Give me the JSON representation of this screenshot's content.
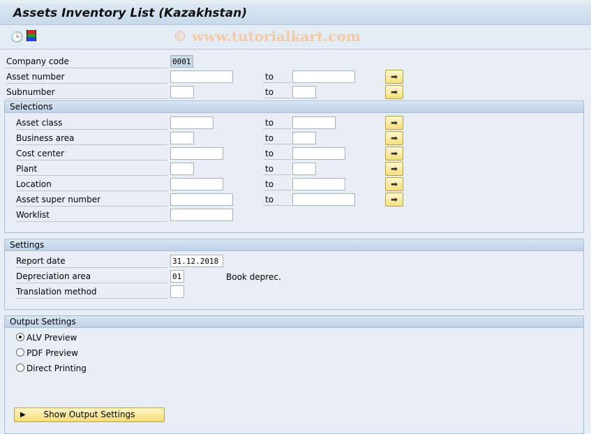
{
  "title": "Assets Inventory List (Kazakhstan)",
  "toolbar": {
    "execute_icon": "clock-execute-icon",
    "variant_icon": "selection-options-icon"
  },
  "watermark": "© www.tutorialkart.com",
  "to_label": "to",
  "main": {
    "company_code": {
      "label": "Company code",
      "value": "0001"
    },
    "asset_number": {
      "label": "Asset number"
    },
    "subnumber": {
      "label": "Subnumber"
    }
  },
  "selections": {
    "title": "Selections",
    "asset_class": "Asset class",
    "business_area": "Business area",
    "cost_center": "Cost center",
    "plant": "Plant",
    "location": "Location",
    "asset_super_number": "Asset super number",
    "worklist": "Worklist"
  },
  "settings": {
    "title": "Settings",
    "report_date": {
      "label": "Report date",
      "value": "31.12.2018"
    },
    "depreciation_area": {
      "label": "Depreciation area",
      "value": "01",
      "description": "Book deprec."
    },
    "translation_method": {
      "label": "Translation method",
      "value": ""
    }
  },
  "output": {
    "title": "Output Settings",
    "options": [
      "ALV Preview",
      "PDF Preview",
      "Direct Printing"
    ],
    "selected": "ALV Preview",
    "button": "Show Output Settings"
  }
}
